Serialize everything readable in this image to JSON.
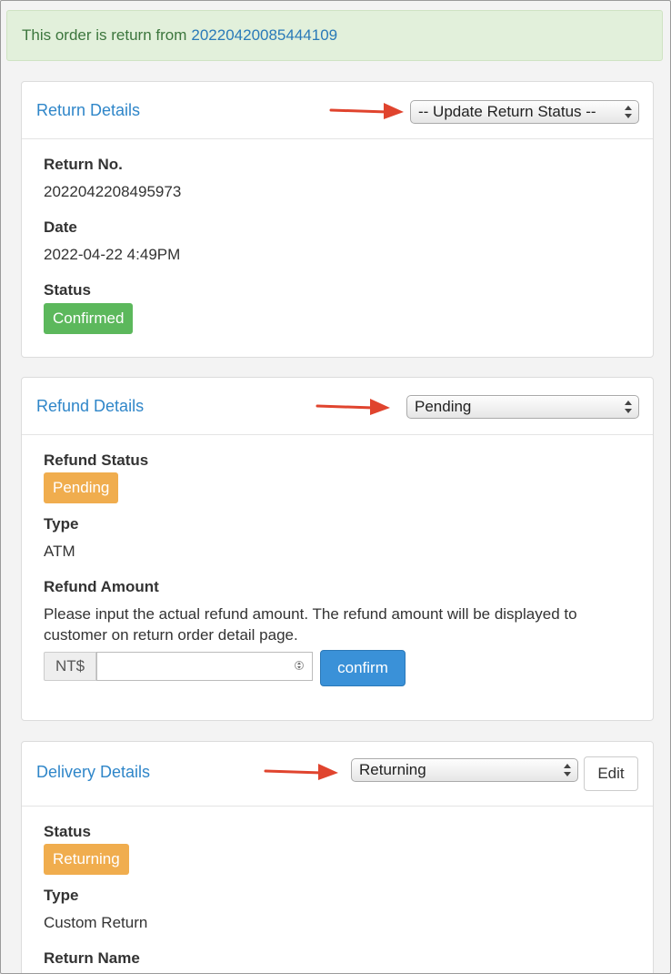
{
  "notice": {
    "text": "This order is return from",
    "order_link": "20220420085444109"
  },
  "return_details": {
    "title": "Return Details",
    "status_select": "-- Update Return Status --",
    "return_no_label": "Return No.",
    "return_no": "2022042208495973",
    "date_label": "Date",
    "date": "2022-04-22 4:49PM",
    "status_label": "Status",
    "status": "Confirmed"
  },
  "refund_details": {
    "title": "Refund Details",
    "status_select": "Pending",
    "refund_status_label": "Refund Status",
    "refund_status": "Pending",
    "type_label": "Type",
    "type": "ATM",
    "amount_label": "Refund Amount",
    "amount_help": "Please input the actual refund amount. The refund amount will be displayed to customer on return order detail page.",
    "currency": "NT$",
    "amount_value": "",
    "confirm_label": "confirm"
  },
  "delivery_details": {
    "title": "Delivery Details",
    "status_select": "Returning",
    "edit_label": "Edit",
    "status_label": "Status",
    "status": "Returning",
    "type_label": "Type",
    "type": "Custom Return",
    "return_name_label": "Return Name"
  },
  "colors": {
    "link": "#2f86c9",
    "success": "#5cb85c",
    "warning": "#f0ad4e",
    "primary": "#3a91d8",
    "arrow": "#e0442e"
  }
}
